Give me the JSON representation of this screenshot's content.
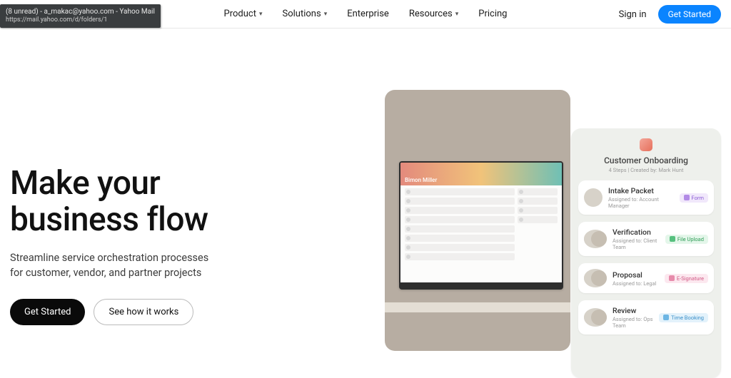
{
  "tab_hint": {
    "title": "(8 unread) - a_makac@yahoo.com - Yahoo Mail",
    "url": "https://mail.yahoo.com/d/folders/1"
  },
  "nav": {
    "items": [
      {
        "label": "Product",
        "dropdown": true
      },
      {
        "label": "Solutions",
        "dropdown": true
      },
      {
        "label": "Enterprise",
        "dropdown": false
      },
      {
        "label": "Resources",
        "dropdown": true
      },
      {
        "label": "Pricing",
        "dropdown": false
      }
    ],
    "signin": "Sign in",
    "cta": "Get Started"
  },
  "hero": {
    "title_l1": "Make your",
    "title_l2": "business flow",
    "sub_l1": "Streamline service orchestration processes",
    "sub_l2": "for customer, vendor, and partner projects",
    "btn_primary": "Get Started",
    "btn_secondary": "See how it works"
  },
  "monitor": {
    "username": "Bimon Miller"
  },
  "card": {
    "title": "Customer Onboarding",
    "meta": "4 Steps | Created by: Mark Hunt",
    "steps": [
      {
        "title": "Intake Packet",
        "sub": "Assigned to: Account Manager",
        "badge": "Form",
        "badge_class": "b-purple",
        "dbl": false
      },
      {
        "title": "Verification",
        "sub": "Assigned to: Client Team",
        "badge": "File Upload",
        "badge_class": "b-green",
        "dbl": true
      },
      {
        "title": "Proposal",
        "sub": "Assigned to: Legal",
        "badge": "E-Signature",
        "badge_class": "b-pink",
        "dbl": true
      },
      {
        "title": "Review",
        "sub": "Assigned to: Ops Team",
        "badge": "Time Booking",
        "badge_class": "b-blue",
        "dbl": true
      }
    ]
  }
}
